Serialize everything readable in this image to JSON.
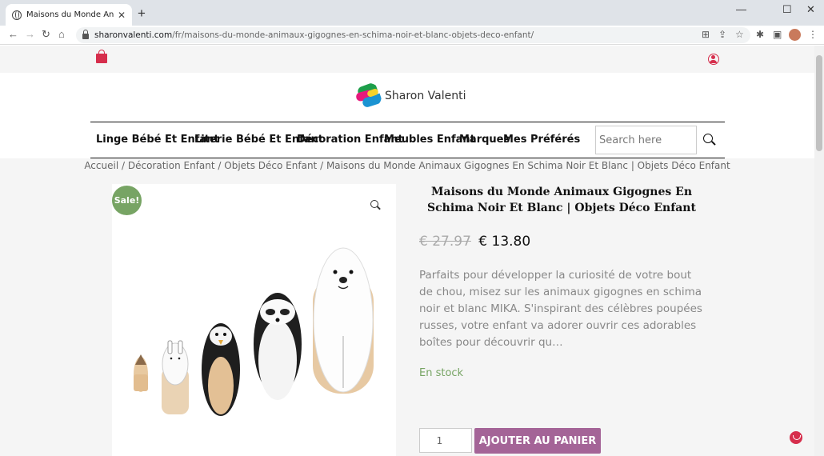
{
  "browser": {
    "tab_title": "Maisons du Monde Animaux Gigognes",
    "url_host": "sharonvalenti.com",
    "url_path": "/fr/maisons-du-monde-animaux-gigognes-en-schima-noir-et-blanc-objets-deco-enfant/",
    "new_tab": "+",
    "close_tab": "✕",
    "minimize": "—",
    "maximize": "☐",
    "close_window": "✕"
  },
  "site": {
    "logo_text": "Sharon Valenti",
    "nav": [
      "Linge Bébé Et Enfant",
      "Literie Bébé Et Enfant",
      "Décoration Enfant",
      "Meubles Enfant",
      "Marques",
      "Mes Préférés"
    ],
    "search_placeholder": "Search here"
  },
  "breadcrumb": {
    "items": [
      "Accueil",
      "Décoration Enfant",
      "Objets Déco Enfant",
      "Maisons du Monde Animaux Gigognes En Schima Noir Et Blanc | Objets Déco Enfant"
    ],
    "separator": " / "
  },
  "product": {
    "sale_badge": "Sale!",
    "title": "Maisons du Monde Animaux Gigognes En Schima Noir Et Blanc | Objets Déco Enfant",
    "old_price": "€ 27.97",
    "new_price": "€ 13.80",
    "description": "Parfaits pour développer la curiosité de votre bout de chou, misez sur les animaux gigognes en schima noir et blanc MIKA. S'inspirant des célèbres poupées russes, votre enfant va adorer ouvrir ces adorables boîtes pour découvrir qu…",
    "stock": "En stock",
    "quantity": "1",
    "add_to_cart": "AJOUTER AU PANIER"
  },
  "colors": {
    "accent": "#d62e4c",
    "sale": "#77a464",
    "cart_button": "#a46497"
  }
}
